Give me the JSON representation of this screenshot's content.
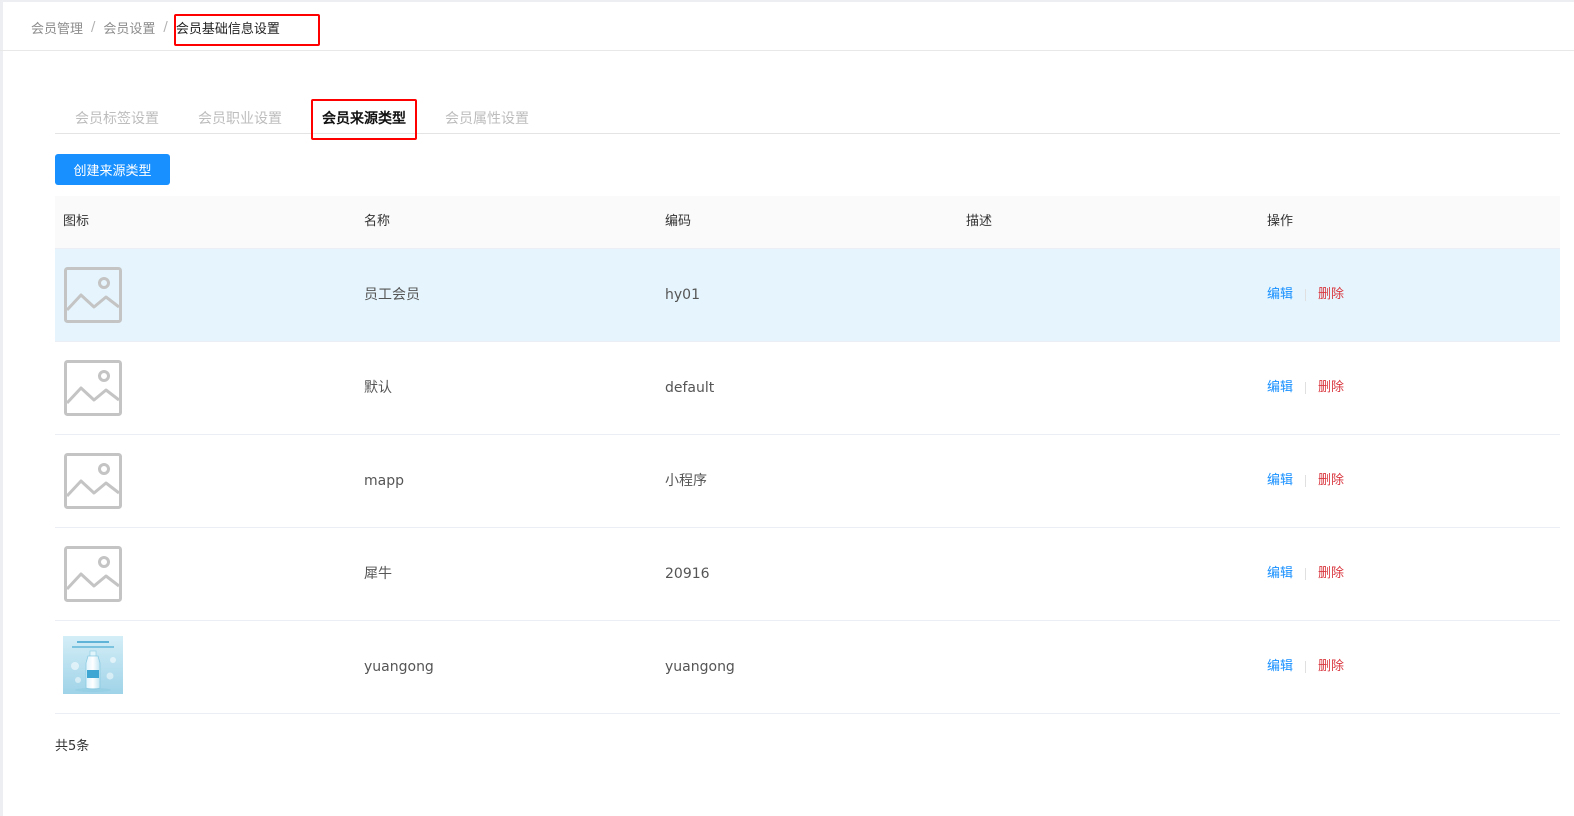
{
  "breadcrumb": {
    "items": [
      "会员管理",
      "会员设置"
    ],
    "separator": "/",
    "current": "会员基础信息设置"
  },
  "tabs": [
    {
      "label": "会员标签设置",
      "active": false
    },
    {
      "label": "会员职业设置",
      "active": false
    },
    {
      "label": "会员来源类型",
      "active": true
    },
    {
      "label": "会员属性设置",
      "active": false
    }
  ],
  "toolbar": {
    "create_label": "创建来源类型"
  },
  "table": {
    "headers": {
      "icon": "图标",
      "name": "名称",
      "code": "编码",
      "desc": "描述",
      "ops": "操作"
    },
    "rows": [
      {
        "icon": "image-placeholder-icon",
        "name": "员工会员",
        "code": "hy01",
        "desc": "",
        "edit": "编辑",
        "delete": "删除",
        "highlighted": true
      },
      {
        "icon": "image-placeholder-icon",
        "name": "默认",
        "code": "default",
        "desc": "",
        "edit": "编辑",
        "delete": "删除",
        "highlighted": false
      },
      {
        "icon": "image-placeholder-icon",
        "name": "mapp",
        "code": "小程序",
        "desc": "",
        "edit": "编辑",
        "delete": "删除",
        "highlighted": false
      },
      {
        "icon": "image-placeholder-icon",
        "name": "犀牛",
        "code": "20916",
        "desc": "",
        "edit": "编辑",
        "delete": "删除",
        "highlighted": false
      },
      {
        "icon": "water-bottle-thumbnail",
        "name": "yuangong",
        "code": "yuangong",
        "desc": "",
        "edit": "编辑",
        "delete": "删除",
        "highlighted": false
      }
    ]
  },
  "footer": {
    "total": "共5条"
  },
  "colors": {
    "primary": "#1890ff",
    "danger": "#d9363e",
    "row_highlight": "#e6f5fd",
    "annotation": "#ff0000"
  }
}
